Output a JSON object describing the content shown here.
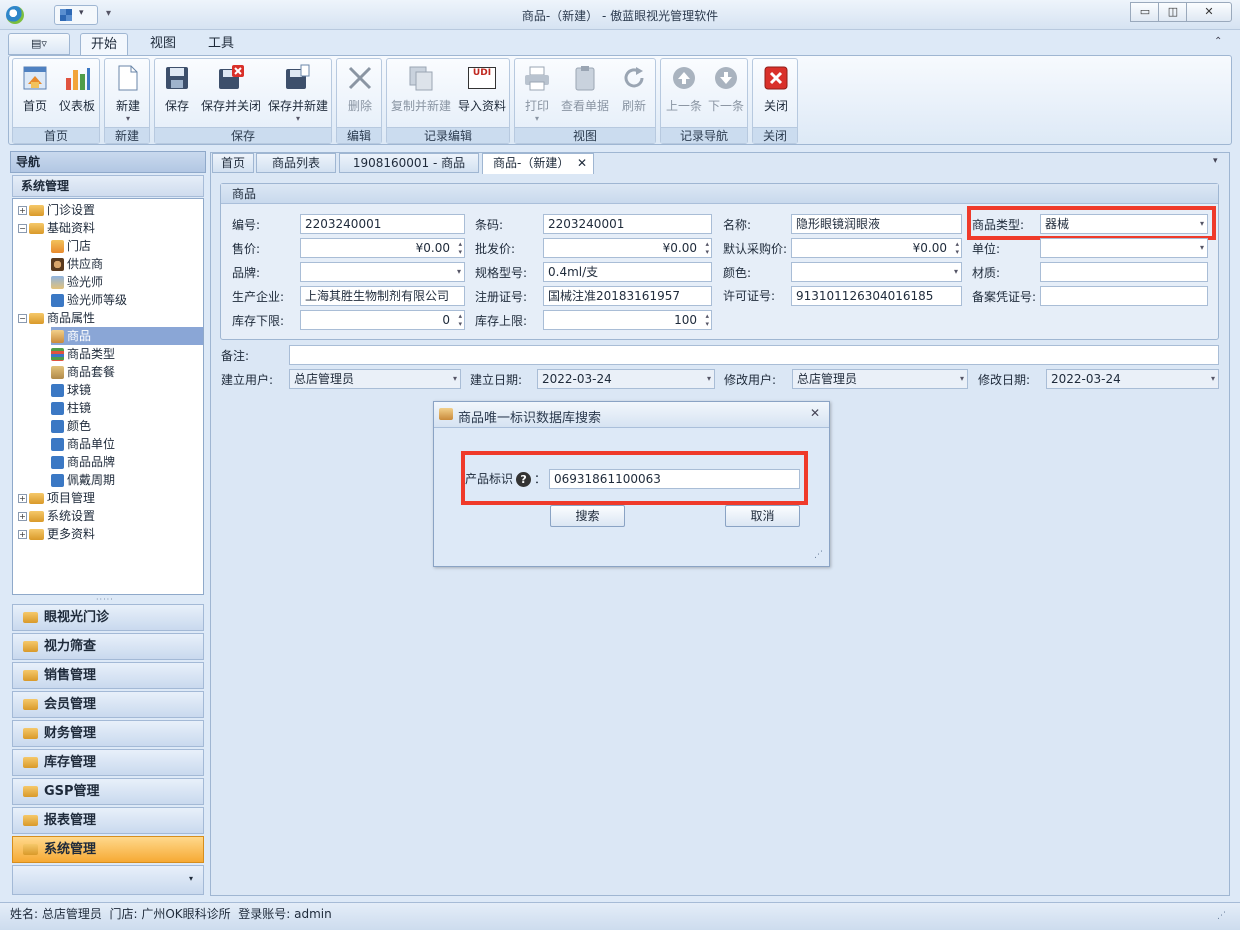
{
  "window": {
    "title": "商品-（新建） - 傲蓝眼视光管理软件"
  },
  "ribbon": {
    "tabs": [
      "开始",
      "视图",
      "工具"
    ],
    "groups": [
      {
        "label": "首页",
        "buttons": [
          "首页",
          "仪表板"
        ]
      },
      {
        "label": "新建",
        "buttons": [
          "新建"
        ]
      },
      {
        "label": "保存",
        "buttons": [
          "保存",
          "保存并关闭",
          "保存并新建"
        ]
      },
      {
        "label": "编辑",
        "buttons": [
          "删除"
        ]
      },
      {
        "label": "记录编辑",
        "buttons": [
          "复制并新建",
          "导入资料"
        ]
      },
      {
        "label": "视图",
        "buttons": [
          "打印",
          "查看单据",
          "刷新"
        ]
      },
      {
        "label": "记录导航",
        "buttons": [
          "上一条",
          "下一条"
        ]
      },
      {
        "label": "关闭",
        "buttons": [
          "关闭"
        ]
      }
    ],
    "udi_badge": "UDI"
  },
  "nav": {
    "header": "导航",
    "section": "系统管理",
    "tree": [
      {
        "label": "门诊设置",
        "pm": "+"
      },
      {
        "label": "基础资料",
        "pm": "−"
      },
      {
        "label": "门店"
      },
      {
        "label": "供应商"
      },
      {
        "label": "验光师"
      },
      {
        "label": "验光师等级"
      },
      {
        "label": "商品属性",
        "pm": "−"
      },
      {
        "label": "商品"
      },
      {
        "label": "商品类型"
      },
      {
        "label": "商品套餐"
      },
      {
        "label": "球镜"
      },
      {
        "label": "柱镜"
      },
      {
        "label": "颜色"
      },
      {
        "label": "商品单位"
      },
      {
        "label": "商品品牌"
      },
      {
        "label": "佩戴周期"
      },
      {
        "label": "项目管理",
        "pm": "+"
      },
      {
        "label": "系统设置",
        "pm": "+"
      },
      {
        "label": "更多资料",
        "pm": "+"
      }
    ],
    "modules": [
      "眼视光门诊",
      "视力筛查",
      "销售管理",
      "会员管理",
      "财务管理",
      "库存管理",
      "GSP管理",
      "报表管理",
      "系统管理"
    ]
  },
  "doc_tabs": [
    "首页",
    "商品列表",
    "1908160001 - 商品",
    "商品-（新建）"
  ],
  "form": {
    "group_title": "商品",
    "code_label": "编号:",
    "code": "2203240001",
    "barcode_label": "条码:",
    "barcode": "2203240001",
    "name_label": "名称:",
    "name": "隐形眼镜润眼液",
    "type_label": "商品类型:",
    "type": "器械",
    "price_label": "售价:",
    "price": "¥0.00",
    "wholesale_label": "批发价:",
    "wholesale": "¥0.00",
    "purchase_label": "默认采购价:",
    "purchase": "¥0.00",
    "unit_label": "单位:",
    "unit": "",
    "brand_label": "品牌:",
    "brand": "",
    "spec_label": "规格型号:",
    "spec": "0.4ml/支",
    "color_label": "颜色:",
    "color": "",
    "material_label": "材质:",
    "material": "",
    "maker_label": "生产企业:",
    "maker": "上海其胜生物制剂有限公司",
    "reg_label": "注册证号:",
    "reg": "国械注准20183161957",
    "license_label": "许可证号:",
    "license": "913101126304016185",
    "record_label": "备案凭证号:",
    "record": "",
    "stock_min_label": "库存下限:",
    "stock_min": "0",
    "stock_max_label": "库存上限:",
    "stock_max": "100",
    "note_label": "备注:",
    "note": "",
    "creator_label": "建立用户:",
    "creator": "总店管理员",
    "created_label": "建立日期:",
    "created": "2022-03-24",
    "modifier_label": "修改用户:",
    "modifier": "总店管理员",
    "modified_label": "修改日期:",
    "modified": "2022-03-24"
  },
  "dialog": {
    "title": "商品唯一标识数据库搜索",
    "field_label": "产品标识",
    "field_suffix": "：",
    "field_value": "06931861100063",
    "search_label": "搜索",
    "cancel_label": "取消"
  },
  "status": {
    "text": "姓名: 总店管理员  门店: 广州OK眼科诊所  登录账号: admin"
  },
  "colors": {
    "highlight": "#ef3a2a",
    "selection": "#8aa6d6",
    "active_module": "#f6a934"
  }
}
